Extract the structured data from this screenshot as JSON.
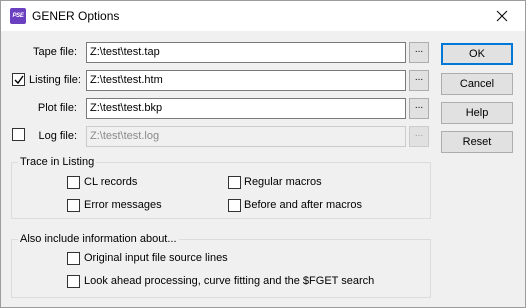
{
  "window": {
    "title": "GENER Options",
    "icon_label": "PSE",
    "icon_color": "#6a3fc0"
  },
  "files": {
    "tape": {
      "label": "Tape file:",
      "value": "Z:\\test\\test.tap",
      "browse": "..."
    },
    "listing": {
      "label": "Listing file:",
      "value": "Z:\\test\\test.htm",
      "browse": "...",
      "checked": true
    },
    "plot": {
      "label": "Plot file:",
      "value": "Z:\\test\\test.bkp",
      "browse": "..."
    },
    "log": {
      "label": "Log file:",
      "value": "Z:\\test\\test.log",
      "browse": "...",
      "checked": false,
      "disabled": true
    }
  },
  "buttons": {
    "ok": "OK",
    "cancel": "Cancel",
    "help": "Help",
    "reset": "Reset"
  },
  "trace": {
    "title": "Trace in Listing",
    "cl_records": "CL records",
    "error_messages": "Error messages",
    "regular_macros": "Regular macros",
    "before_after_macros": "Before and after macros"
  },
  "include": {
    "title": "Also include information about...",
    "original_input": "Original input file source lines",
    "look_ahead": "Look ahead processing, curve fitting and the $FGET search"
  },
  "colors": {
    "accent": "#0078d7",
    "background": "#f0f0f0"
  }
}
